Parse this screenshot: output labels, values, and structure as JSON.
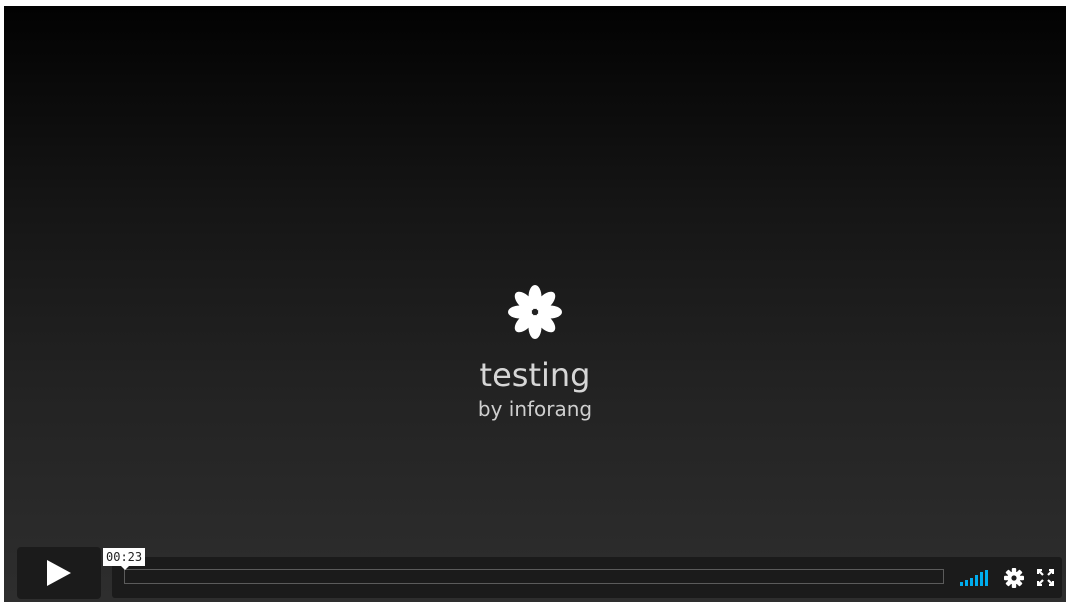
{
  "video": {
    "title": "testing",
    "byline": "by inforang"
  },
  "controls": {
    "time_tooltip": "00:23",
    "play_icon": "play-icon",
    "volume_icon": "volume-bars-icon",
    "settings_icon": "gear-icon",
    "fullscreen_icon": "fullscreen-icon",
    "accent_color": "#00adef"
  }
}
